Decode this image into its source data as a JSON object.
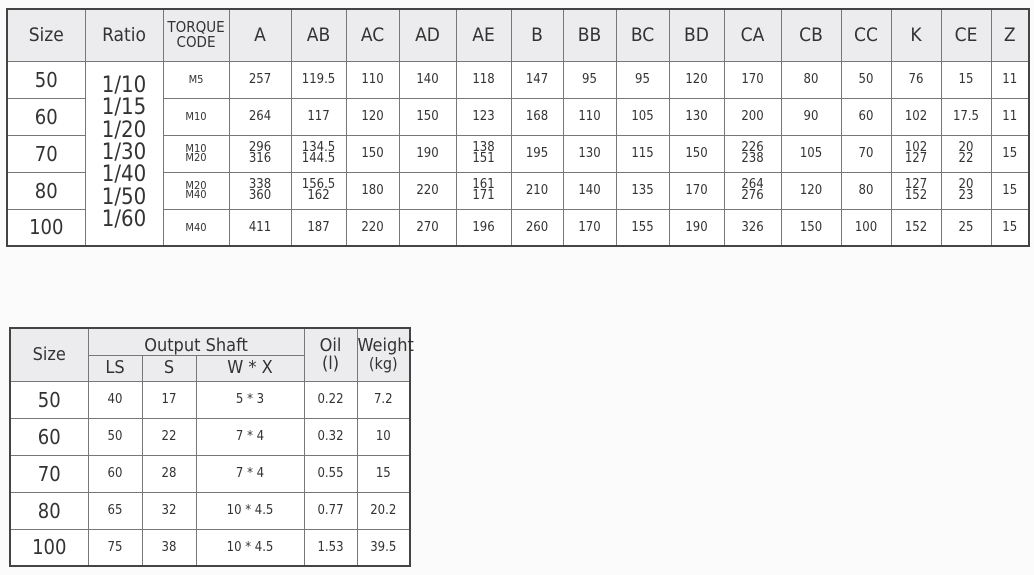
{
  "dimension_table": {
    "headers": [
      "Size",
      "Ratio",
      "TORQUE CODE",
      "A",
      "AB",
      "AC",
      "AD",
      "AE",
      "B",
      "BB",
      "BC",
      "BD",
      "CA",
      "CB",
      "CC",
      "K",
      "CE",
      "Z"
    ],
    "ratios": [
      "1/10",
      "1/15",
      "1/20",
      "1/30",
      "1/40",
      "1/50",
      "1/60"
    ],
    "rows": [
      {
        "size": "50",
        "cells": [
          [
            "M5"
          ],
          [
            "257"
          ],
          [
            "119.5"
          ],
          [
            "110"
          ],
          [
            "140"
          ],
          [
            "118"
          ],
          [
            "147"
          ],
          [
            "95"
          ],
          [
            "95"
          ],
          [
            "120"
          ],
          [
            "170"
          ],
          [
            "80"
          ],
          [
            "50"
          ],
          [
            "76"
          ],
          [
            "15"
          ],
          [
            "11"
          ]
        ]
      },
      {
        "size": "60",
        "cells": [
          [
            "M10"
          ],
          [
            "264"
          ],
          [
            "117"
          ],
          [
            "120"
          ],
          [
            "150"
          ],
          [
            "123"
          ],
          [
            "168"
          ],
          [
            "110"
          ],
          [
            "105"
          ],
          [
            "130"
          ],
          [
            "200"
          ],
          [
            "90"
          ],
          [
            "60"
          ],
          [
            "102"
          ],
          [
            "17.5"
          ],
          [
            "11"
          ]
        ]
      },
      {
        "size": "70",
        "cells": [
          [
            "M10",
            "M20"
          ],
          [
            "296",
            "316"
          ],
          [
            "134.5",
            "144.5"
          ],
          [
            "150"
          ],
          [
            "190"
          ],
          [
            "138",
            "151"
          ],
          [
            "195"
          ],
          [
            "130"
          ],
          [
            "115"
          ],
          [
            "150"
          ],
          [
            "226",
            "238"
          ],
          [
            "105"
          ],
          [
            "70"
          ],
          [
            "102",
            "127"
          ],
          [
            "20",
            "22"
          ],
          [
            "15"
          ]
        ]
      },
      {
        "size": "80",
        "cells": [
          [
            "M20",
            "M40"
          ],
          [
            "338",
            "360"
          ],
          [
            "156.5",
            "162"
          ],
          [
            "180"
          ],
          [
            "220"
          ],
          [
            "161",
            "171"
          ],
          [
            "210"
          ],
          [
            "140"
          ],
          [
            "135"
          ],
          [
            "170"
          ],
          [
            "264",
            "276"
          ],
          [
            "120"
          ],
          [
            "80"
          ],
          [
            "127",
            "152"
          ],
          [
            "20",
            "23"
          ],
          [
            "15"
          ]
        ]
      },
      {
        "size": "100",
        "cells": [
          [
            "M40"
          ],
          [
            "411"
          ],
          [
            "187"
          ],
          [
            "220"
          ],
          [
            "270"
          ],
          [
            "196"
          ],
          [
            "260"
          ],
          [
            "170"
          ],
          [
            "155"
          ],
          [
            "190"
          ],
          [
            "326"
          ],
          [
            "150"
          ],
          [
            "100"
          ],
          [
            "152"
          ],
          [
            "25"
          ],
          [
            "15"
          ]
        ]
      }
    ]
  },
  "shaft_table": {
    "size_label": "Size",
    "group_label": "Output Shaft",
    "sub_headers": [
      "LS",
      "S",
      "W * X"
    ],
    "oil_label": [
      "Oil",
      "(l)"
    ],
    "weight_label": [
      "Weight",
      "(kg)"
    ],
    "rows": [
      [
        "50",
        "40",
        "17",
        "5 * 3",
        "0.22",
        "7.2"
      ],
      [
        "60",
        "50",
        "22",
        "7 * 4",
        "0.32",
        "10"
      ],
      [
        "70",
        "60",
        "28",
        "7 * 4",
        "0.55",
        "15"
      ],
      [
        "80",
        "65",
        "32",
        "10 * 4.5",
        "0.77",
        "20.2"
      ],
      [
        "100",
        "75",
        "38",
        "10 * 4.5",
        "1.53",
        "39.5"
      ]
    ]
  }
}
